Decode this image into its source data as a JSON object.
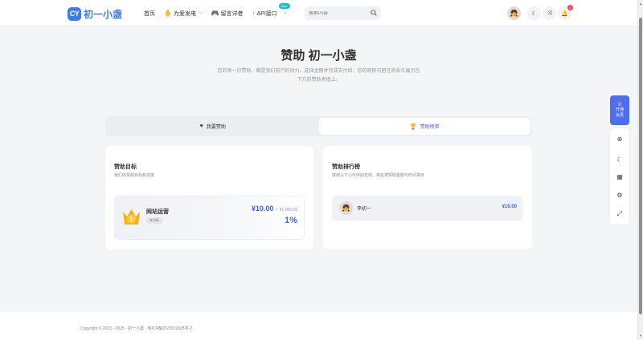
{
  "header": {
    "logo_mark": "CY",
    "logo_text": "初一小盏",
    "nav": [
      {
        "label": "首页",
        "icon": "",
        "has_dropdown": false
      },
      {
        "label": "为爱发电",
        "icon": "hands-icon",
        "has_dropdown": true
      },
      {
        "label": "留言详者",
        "icon": "game-controller-icon",
        "has_dropdown": false
      },
      {
        "label": "API接口",
        "icon": "rocket-icon",
        "has_dropdown": true,
        "badge": "New"
      }
    ],
    "search_placeholder": "搜索内容",
    "notification_count": "1"
  },
  "hero": {
    "title": "赞助 初一小盏",
    "description_line1": "您的每一份赞助，都是我们前行的动力。选择金额并完成支付后，您的昵称与留言将永久展示在",
    "description_line2": "下方的赞助者墙上。"
  },
  "tabs": [
    {
      "label": "我要赞助",
      "icon": "heart-icon",
      "active": false
    },
    {
      "label": "赞助榜单",
      "icon": "trophy-icon",
      "active": true
    }
  ],
  "goals_card": {
    "title": "赞助目标",
    "subtitle": "我们的赞助目标和进度",
    "goal": {
      "rank": "1",
      "name": "网站运营",
      "tag": "年目标",
      "current": "¥10.00",
      "separator": "/",
      "target": "¥1,000.00",
      "percent": "1%",
      "progress": 0.01
    }
  },
  "ranking_card": {
    "title": "赞助排行榜",
    "subtitle": "感谢以下小伙伴的支持，排名按赞助金额与时间排序",
    "entries": [
      {
        "name": "李初一",
        "amount": "¥10.00"
      }
    ]
  },
  "floating": {
    "vip_line1": "开通",
    "vip_line2": "会员"
  },
  "footer": {
    "text": "Copyright © 2023 - 2025 · 初一小盏 · 皖ICP备2023019308号-2 ."
  },
  "colors": {
    "accent": "#3b64f5",
    "brand": "#3c7cf0",
    "vip": "#4e6ef2",
    "badge_new": "#22b8cf",
    "notification": "#f5455c",
    "crown": "#f5b316"
  }
}
